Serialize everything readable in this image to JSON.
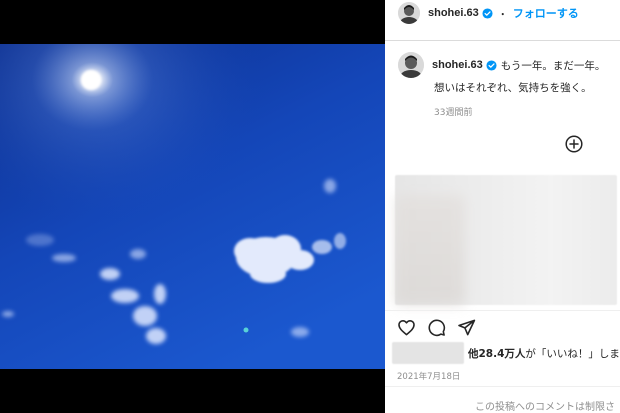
{
  "post": {
    "username": "shohei.63",
    "follow_label": "フォローする",
    "separator": "・",
    "caption_line1": "もう一年。まだ一年。",
    "caption_line2": "想いはそれぞれ、気持ちを強く。",
    "time_ago": "33週間前"
  },
  "likes": {
    "prefix": "他",
    "count": "28.4万人",
    "suffix": "が「いいね！」しま"
  },
  "date": "2021年7月18日",
  "comment_notice": "この投稿へのコメントは制限さ",
  "icons": {
    "verified": "verified-badge-icon",
    "add": "plus-circle-icon",
    "like": "heart-icon",
    "comment": "comment-bubble-icon",
    "share": "paper-plane-icon"
  },
  "colors": {
    "accent": "#0095f6",
    "text": "#262626",
    "muted": "#8e8e8e",
    "sky_top": "#0d3ea8",
    "sky_bottom": "#1a53c7"
  }
}
